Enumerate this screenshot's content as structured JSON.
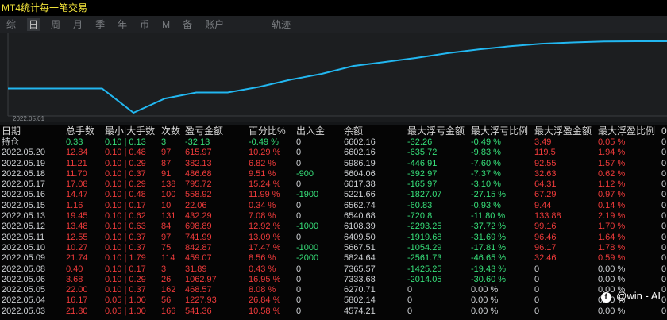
{
  "window": {
    "title": "MT4统计每一笔交易"
  },
  "tabs": [
    "综",
    "日",
    "周",
    "月",
    "季",
    "年",
    "币",
    "M",
    "备",
    "账户",
    "轨迹"
  ],
  "active_tab": "日",
  "chart": {
    "x_tick_label": "2022.05.01",
    "line_color": "#22b7f0",
    "equity_values": [
      6602.16,
      6602.16,
      6602.16,
      6602.16,
      5802.14,
      6271.72,
      6471.53,
      6471.53,
      6653.88,
      6893.21,
      7087.48,
      7347.23,
      7478.6,
      7612.1,
      7768.72,
      7892.71,
      7997.21,
      8081.42,
      8122.6,
      8158.8,
      8163.2,
      8163.2
    ]
  },
  "table": {
    "headers": [
      "日期",
      "总手数",
      "最小|大手数",
      "次数",
      "盈亏金额",
      "百分比%",
      "出入金",
      "余额",
      "最大浮亏金额",
      "最大浮亏比例",
      "最大浮盈金额",
      "最大浮盈比例",
      "0"
    ],
    "holding": {
      "date": "持仓",
      "lots": "0.33",
      "minmax": "0.10 | 0.13",
      "count": "3",
      "pnl": "-32.13",
      "pct": "-0.49 %",
      "io": "0",
      "balance": "6602.16",
      "maxloss": "-32.26",
      "maxlosspct": "-0.49 %",
      "maxprofit": "3.49",
      "maxprofitpct": "0.05 %",
      "last": "0"
    },
    "rows": [
      {
        "date": "2022.05.20",
        "lots": "12.84",
        "minmax": "0.10 | 0.48",
        "count": "97",
        "pnl": "615.97",
        "pct": "10.29 %",
        "io": "0",
        "balance": "6602.16",
        "maxloss": "-635.72",
        "maxlosspct": "-9.83 %",
        "maxprofit": "119.5",
        "maxprofitpct": "1.94 %",
        "last": "0"
      },
      {
        "date": "2022.05.19",
        "lots": "11.21",
        "minmax": "0.10 | 0.29",
        "count": "87",
        "pnl": "382.13",
        "pct": "6.82 %",
        "io": "0",
        "balance": "5986.19",
        "maxloss": "-446.91",
        "maxlosspct": "-7.60 %",
        "maxprofit": "92.55",
        "maxprofitpct": "1.57 %",
        "last": "0"
      },
      {
        "date": "2022.05.18",
        "lots": "11.70",
        "minmax": "0.10 | 0.37",
        "count": "91",
        "pnl": "486.68",
        "pct": "9.51 %",
        "io": "-900",
        "balance": "5604.06",
        "maxloss": "-392.97",
        "maxlosspct": "-7.37 %",
        "maxprofit": "32.63",
        "maxprofitpct": "0.62 %",
        "last": "0"
      },
      {
        "date": "2022.05.17",
        "lots": "17.08",
        "minmax": "0.10 | 0.29",
        "count": "138",
        "pnl": "795.72",
        "pct": "15.24 %",
        "io": "0",
        "balance": "6017.38",
        "maxloss": "-165.97",
        "maxlosspct": "-3.10 %",
        "maxprofit": "64.31",
        "maxprofitpct": "1.12 %",
        "last": "0"
      },
      {
        "date": "2022.05.16",
        "lots": "14.47",
        "minmax": "0.10 | 0.48",
        "count": "100",
        "pnl": "558.92",
        "pct": "11.99 %",
        "io": "-1900",
        "balance": "5221.66",
        "maxloss": "-1827.07",
        "maxlosspct": "-27.15 %",
        "maxprofit": "67.29",
        "maxprofitpct": "0.97 %",
        "last": "0"
      },
      {
        "date": "2022.05.15",
        "lots": "1.16",
        "minmax": "0.10 | 0.17",
        "count": "10",
        "pnl": "22.06",
        "pct": "0.34 %",
        "io": "0",
        "balance": "6562.74",
        "maxloss": "-60.83",
        "maxlosspct": "-0.93 %",
        "maxprofit": "9.44",
        "maxprofitpct": "0.14 %",
        "last": "0"
      },
      {
        "date": "2022.05.13",
        "lots": "19.45",
        "minmax": "0.10 | 0.62",
        "count": "131",
        "pnl": "432.29",
        "pct": "7.08 %",
        "io": "0",
        "balance": "6540.68",
        "maxloss": "-720.8",
        "maxlosspct": "-11.80 %",
        "maxprofit": "133.88",
        "maxprofitpct": "2.19 %",
        "last": "0"
      },
      {
        "date": "2022.05.12",
        "lots": "13.48",
        "minmax": "0.10 | 0.63",
        "count": "84",
        "pnl": "698.89",
        "pct": "12.92 %",
        "io": "-1000",
        "balance": "6108.39",
        "maxloss": "-2293.25",
        "maxlosspct": "-37.72 %",
        "maxprofit": "99.16",
        "maxprofitpct": "1.70 %",
        "last": "0"
      },
      {
        "date": "2022.05.11",
        "lots": "12.55",
        "minmax": "0.10 | 0.37",
        "count": "97",
        "pnl": "741.99",
        "pct": "13.09 %",
        "io": "0",
        "balance": "6409.50",
        "maxloss": "-1919.68",
        "maxlosspct": "-31.69 %",
        "maxprofit": "96.46",
        "maxprofitpct": "1.64 %",
        "last": "0"
      },
      {
        "date": "2022.05.10",
        "lots": "10.27",
        "minmax": "0.10 | 0.37",
        "count": "75",
        "pnl": "842.87",
        "pct": "17.47 %",
        "io": "-1000",
        "balance": "5667.51",
        "maxloss": "-1054.29",
        "maxlosspct": "-17.81 %",
        "maxprofit": "96.17",
        "maxprofitpct": "1.78 %",
        "last": "0"
      },
      {
        "date": "2022.05.09",
        "lots": "21.74",
        "minmax": "0.10 | 1.79",
        "count": "114",
        "pnl": "459.07",
        "pct": "8.56 %",
        "io": "-2000",
        "balance": "5824.64",
        "maxloss": "-2561.73",
        "maxlosspct": "-46.65 %",
        "maxprofit": "32.46",
        "maxprofitpct": "0.59 %",
        "last": "0"
      },
      {
        "date": "2022.05.08",
        "lots": "0.40",
        "minmax": "0.10 | 0.17",
        "count": "3",
        "pnl": "31.89",
        "pct": "0.43 %",
        "io": "0",
        "balance": "7365.57",
        "maxloss": "-1425.25",
        "maxlosspct": "-19.43 %",
        "maxprofit": "0",
        "maxprofitpct": "0.00 %",
        "last": "0"
      },
      {
        "date": "2022.05.06",
        "lots": "3.68",
        "minmax": "0.10 | 0.29",
        "count": "26",
        "pnl": "1062.97",
        "pct": "16.95 %",
        "io": "0",
        "balance": "7333.68",
        "maxloss": "-2014.05",
        "maxlosspct": "-30.60 %",
        "maxprofit": "0",
        "maxprofitpct": "0.00 %",
        "last": "0"
      },
      {
        "date": "2022.05.05",
        "lots": "22.00",
        "minmax": "0.10 | 0.37",
        "count": "162",
        "pnl": "468.57",
        "pct": "8.08 %",
        "io": "0",
        "balance": "6270.71",
        "maxloss": "0",
        "maxlosspct": "0.00 %",
        "maxprofit": "0",
        "maxprofitpct": "0.00 %",
        "last": "0"
      },
      {
        "date": "2022.05.04",
        "lots": "16.17",
        "minmax": "0.05 | 1.00",
        "count": "56",
        "pnl": "1227.93",
        "pct": "26.84 %",
        "io": "0",
        "balance": "5802.14",
        "maxloss": "0",
        "maxlosspct": "0.00 %",
        "maxprofit": "0",
        "maxprofitpct": "0.00 %",
        "last": "0"
      },
      {
        "date": "2022.05.03",
        "lots": "21.80",
        "minmax": "0.05 | 1.00",
        "count": "166",
        "pnl": "541.36",
        "pct": "10.58 %",
        "io": "0",
        "balance": "4574.21",
        "maxloss": "0",
        "maxlosspct": "0.00 %",
        "maxprofit": "0",
        "maxprofitpct": "0.00 %",
        "last": "0"
      }
    ]
  },
  "watermark": {
    "logo_text": "f",
    "text": "@win - AI"
  },
  "colors": {
    "positive": "#37e07a",
    "negative": "#ef3b3b",
    "neutral": "#cfd2d5",
    "title": "#f2e33a"
  }
}
